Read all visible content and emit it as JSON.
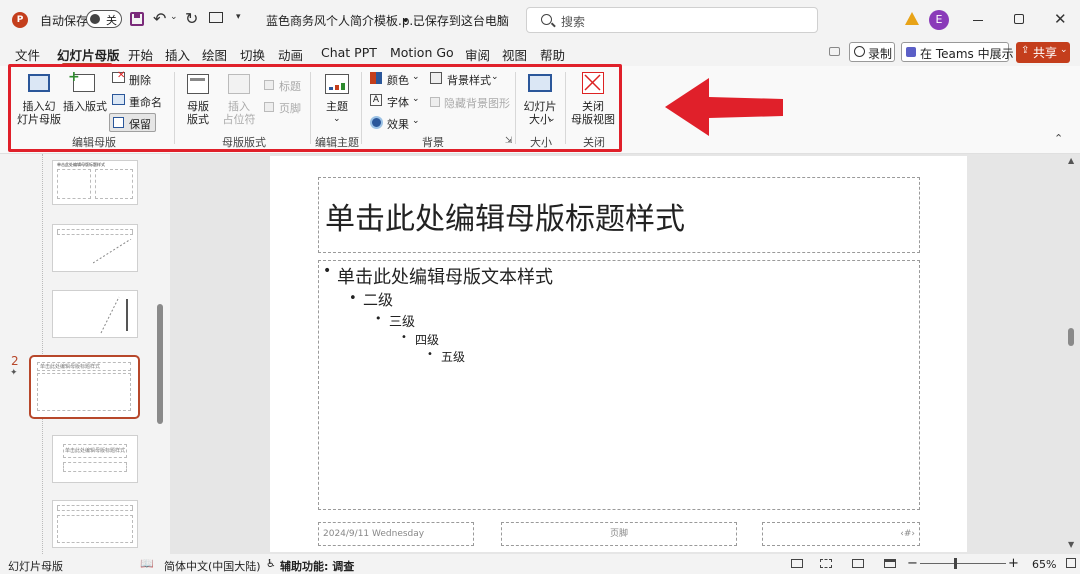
{
  "titlebar": {
    "app_icon": "powerpoint-logo",
    "autosave_label": "自动保存",
    "autosave_state": "关",
    "doc_title": "蓝色商务风个人简介模板.p...",
    "save_status": "• 已保存到这台电脑",
    "search_placeholder": "搜索",
    "avatar_letter": "E",
    "warning_color": "#e8a317",
    "avatar_color": "#8a3ab9"
  },
  "menu": {
    "items": [
      "文件",
      "幻灯片母版",
      "开始",
      "插入",
      "绘图",
      "切换",
      "动画",
      "Chat PPT",
      "Motion Go",
      "审阅",
      "视图",
      "帮助"
    ],
    "active_index": 1,
    "record_label": "录制",
    "teams_label": "在 Teams 中展示",
    "share_label": "共享",
    "share_color": "#c43e1c"
  },
  "ribbon": {
    "insert_master": "插入幻\n灯片母版",
    "insert_layout": "插入版式",
    "delete": "删除",
    "rename": "重命名",
    "preserve": "保留",
    "group_edit_master": "编辑母版",
    "master_layout": "母版\n版式",
    "insert_placeholder": "插入\n占位符",
    "title_chk": "标题",
    "footer_chk": "页脚",
    "group_master_layout": "母版版式",
    "theme": "主题",
    "group_edit_theme": "编辑主题",
    "colors": "颜色",
    "fonts": "字体",
    "effects": "效果",
    "bg_styles": "背景样式",
    "hide_bg": "隐藏背景图形",
    "group_background": "背景",
    "slide_size": "幻灯片\n大小",
    "group_size": "大小",
    "close_master": "关闭\n母版视图",
    "group_close": "关闭",
    "highlight_color": "#e0202a"
  },
  "thumbs": {
    "selected_number": "2",
    "t1_title": "单击此处编辑母版标题样式",
    "t4_title": "单击此处编辑母版标题样式",
    "t5_title": "单击此处编辑母版标题样式",
    "selected_color": "#b7472a"
  },
  "slide": {
    "title": "单击此处编辑母版标题样式",
    "levels": [
      "单击此处编辑母版文本样式",
      "二级",
      "三级",
      "四级",
      "五级"
    ],
    "date": "2024/9/11 Wednesday",
    "footer": "页脚",
    "page_num": "‹#›"
  },
  "status": {
    "view": "幻灯片母版",
    "language": "简体中文(中国大陆)",
    "accessibility": "辅助功能: 调查",
    "zoom": "65%",
    "zoom_fraction": 0.65
  }
}
